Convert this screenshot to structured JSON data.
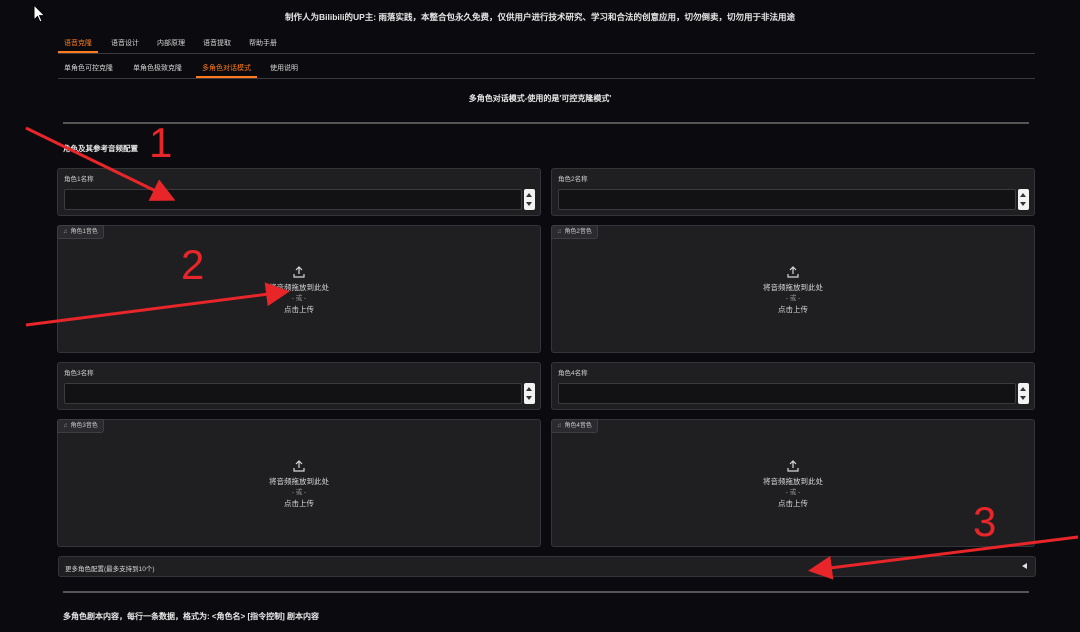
{
  "header": {
    "notice": "制作人为Bilibili的UP主: 雨落实践，本整合包永久免费，仅供用户进行技术研究、学习和合法的创意应用，切勿倒卖，切勿用于非法用途"
  },
  "main_tabs": [
    {
      "label": "语音克隆",
      "active": true
    },
    {
      "label": "语音设计",
      "active": false
    },
    {
      "label": "内部原理",
      "active": false
    },
    {
      "label": "语音提取",
      "active": false
    },
    {
      "label": "帮助手册",
      "active": false
    }
  ],
  "sub_tabs": [
    {
      "label": "单角色可控克隆",
      "active": false
    },
    {
      "label": "单角色极致克隆",
      "active": false
    },
    {
      "label": "多角色对话模式",
      "active": true
    },
    {
      "label": "使用说明",
      "active": false
    }
  ],
  "section_title": "多角色对话模式-使用的是'可控克隆模式'",
  "group_label": "角色及其参考音频配置",
  "roles": [
    {
      "name_label": "角色1名称",
      "audio_label": "角色1音色",
      "name_value": ""
    },
    {
      "name_label": "角色2名称",
      "audio_label": "角色2音色",
      "name_value": ""
    },
    {
      "name_label": "角色3名称",
      "audio_label": "角色3音色",
      "name_value": ""
    },
    {
      "name_label": "角色4名称",
      "audio_label": "角色4音色",
      "name_value": ""
    }
  ],
  "upload": {
    "drop_text": "将音频拖放到此处",
    "or_text": "- 或 -",
    "click_text": "点击上传"
  },
  "more_roles": {
    "label": "更多角色配置(最多支持到10个)"
  },
  "script_label": "多角色剧本内容，每行一条数据，格式为: <角色名> [指令控制] 剧本内容",
  "annotations": {
    "numbers": [
      "1",
      "2",
      "3"
    ],
    "color": "#e8262a"
  },
  "colors": {
    "accent": "#ff7a1a",
    "background": "#0b0b0f",
    "panel": "#1f1f22"
  }
}
